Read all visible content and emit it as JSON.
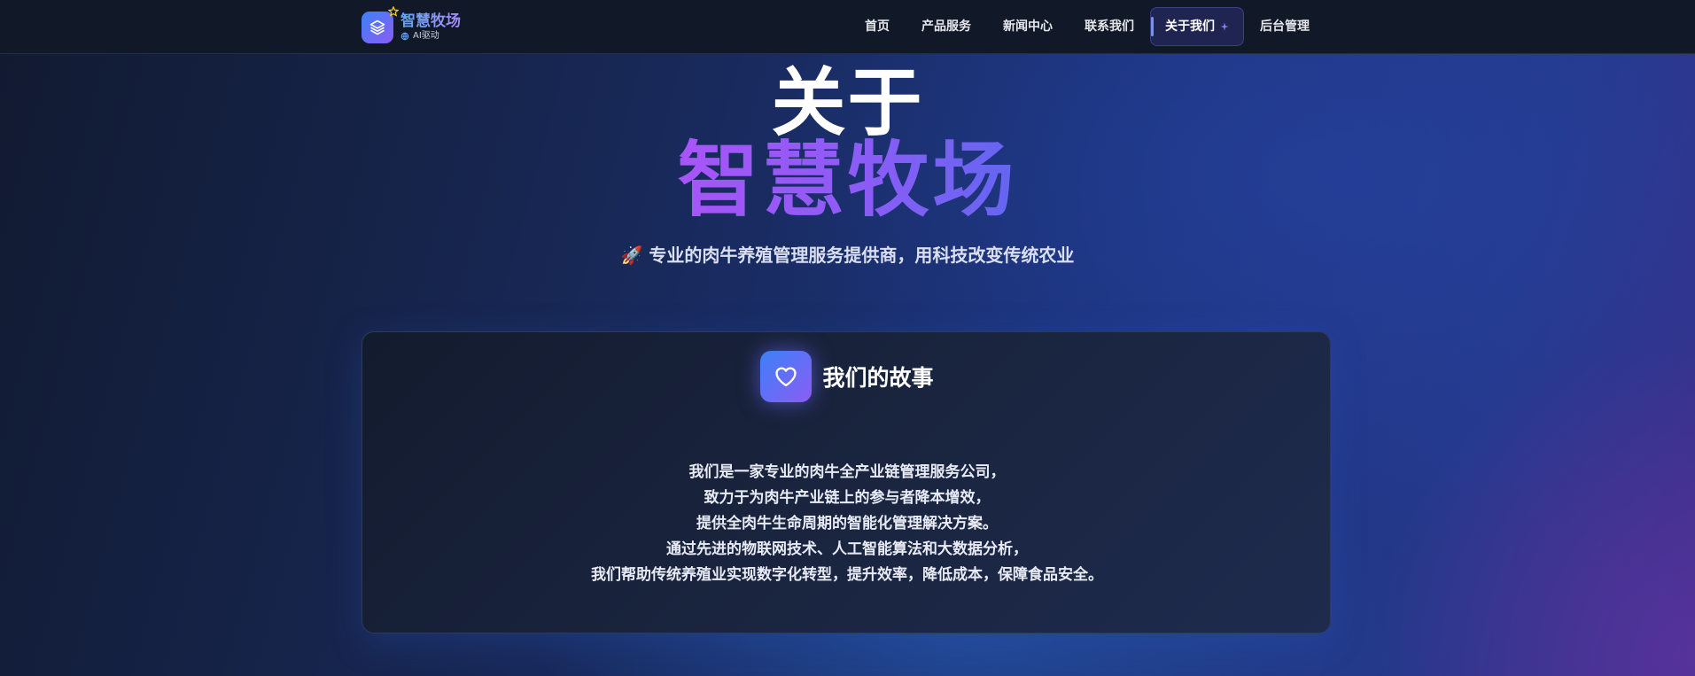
{
  "brand": {
    "name": "智慧牧场",
    "sub": "AI驱动"
  },
  "nav": {
    "items": [
      {
        "label": "首页"
      },
      {
        "label": "产品服务"
      },
      {
        "label": "新闻中心"
      },
      {
        "label": "联系我们"
      },
      {
        "label": "关于我们",
        "active": true
      },
      {
        "label": "后台管理"
      }
    ]
  },
  "hero": {
    "title_line1": "关于",
    "title_line2": "智慧牧场",
    "subtitle": "🚀 专业的肉牛养殖管理服务提供商，用科技改变传统农业"
  },
  "story": {
    "icon": "heart-icon",
    "title": "我们的故事",
    "lines": [
      "我们是一家专业的肉牛全产业链管理服务公司，",
      "致力于为肉牛产业链上的参与者降本增效，",
      "提供全肉牛生命周期的智能化管理解决方案。",
      "通过先进的物联网技术、人工智能算法和大数据分析，",
      "我们帮助传统养殖业实现数字化转型，提升效率，降低成本，保障食品安全。"
    ]
  },
  "colors": {
    "accent_blue": "#3b82f6",
    "accent_purple": "#8b5cf6",
    "nav_bg": "#111827"
  }
}
